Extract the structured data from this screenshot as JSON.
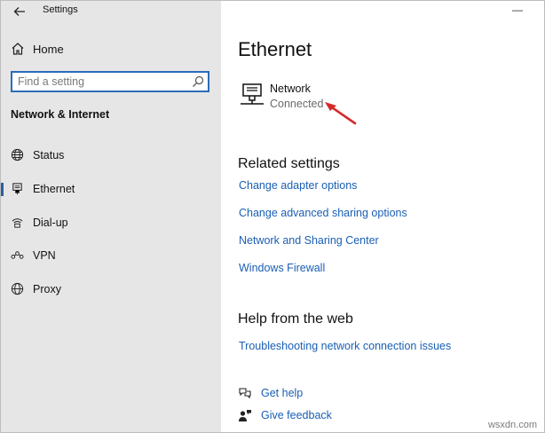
{
  "window": {
    "title": "Settings",
    "minimize_glyph": "—"
  },
  "sidebar": {
    "home_label": "Home",
    "search": {
      "placeholder": "Find a setting",
      "value": ""
    },
    "section_title": "Network & Internet",
    "items": [
      {
        "label": "Status",
        "icon": "globe-status-icon"
      },
      {
        "label": "Ethernet",
        "icon": "ethernet-icon",
        "active": true
      },
      {
        "label": "Dial-up",
        "icon": "dialup-icon"
      },
      {
        "label": "VPN",
        "icon": "vpn-icon"
      },
      {
        "label": "Proxy",
        "icon": "globe-icon"
      }
    ]
  },
  "main": {
    "title": "Ethernet",
    "network": {
      "name": "Network",
      "status": "Connected"
    },
    "related": {
      "heading": "Related settings",
      "links": [
        "Change adapter options",
        "Change advanced sharing options",
        "Network and Sharing Center",
        "Windows Firewall"
      ]
    },
    "help": {
      "heading": "Help from the web",
      "links": [
        "Troubleshooting network connection issues"
      ]
    },
    "footer": {
      "get_help": "Get help",
      "give_feedback": "Give feedback"
    }
  },
  "watermark": "wsxdn.com",
  "colors": {
    "accent": "#2b6cb8",
    "link": "#1a5fb4",
    "sidebar_bg": "#e6e6e6",
    "annotation_arrow": "#d42a2a"
  }
}
